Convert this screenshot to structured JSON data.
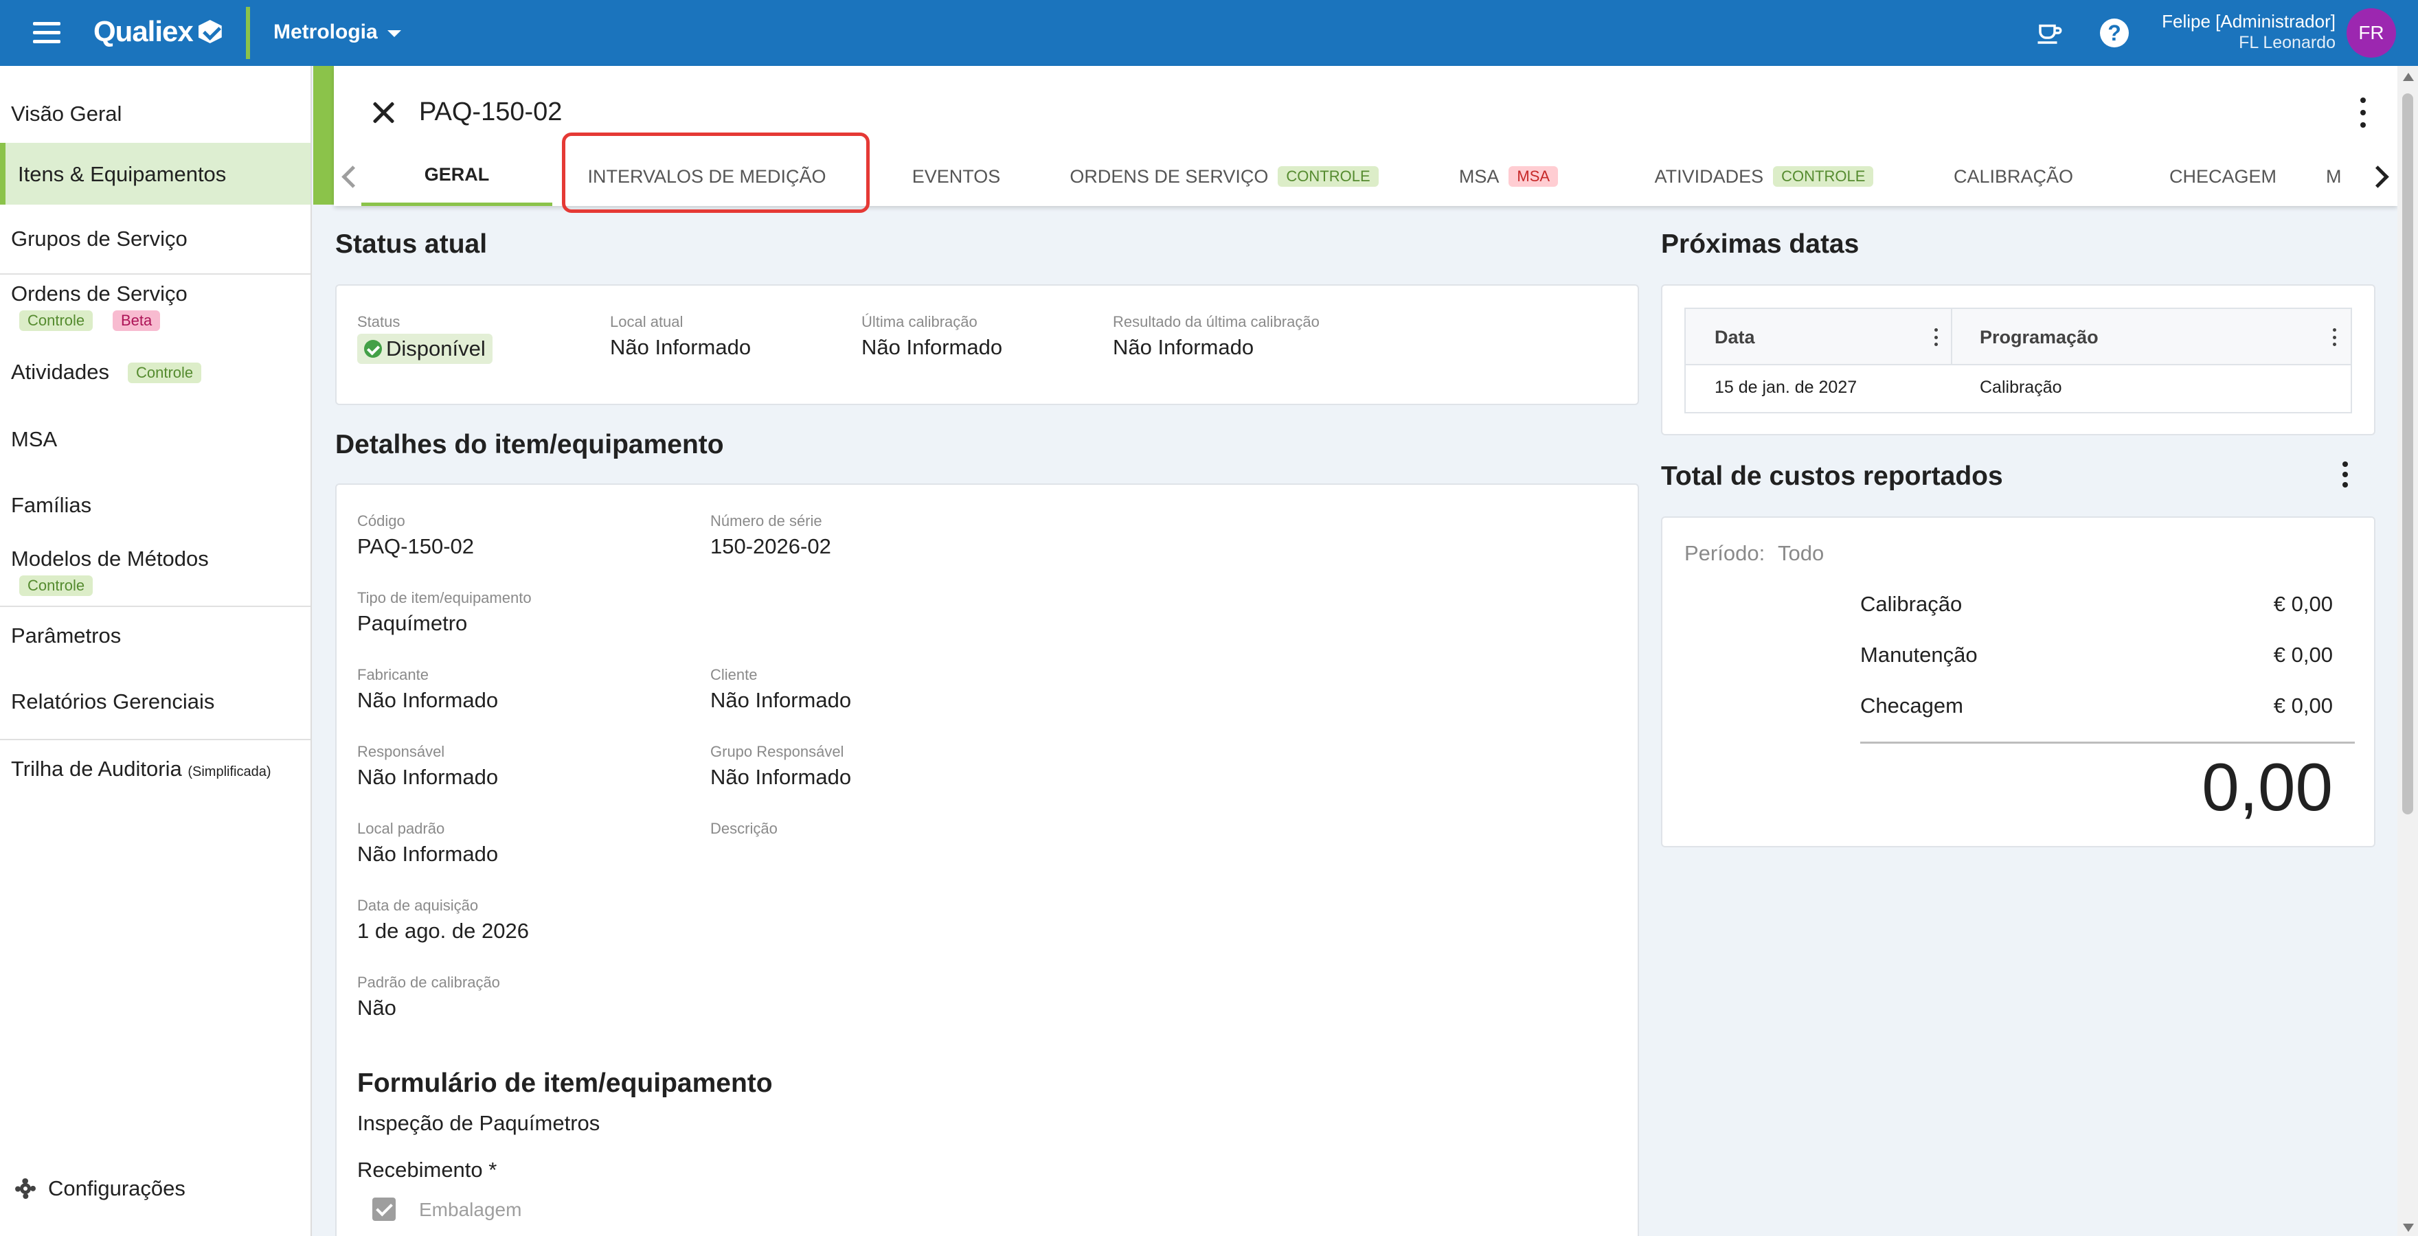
{
  "app": {
    "logo_text": "Qualiex",
    "module": "Metrologia",
    "user_name": "Felipe [Administrador]",
    "user_company": "FL Leonardo",
    "user_initials": "FR",
    "colors": {
      "topbar": "#1b74bd",
      "accent": "#8bc34a",
      "avatar": "#9c27b0",
      "highlight": "#e53935"
    }
  },
  "sidebar": {
    "items": [
      {
        "label": "Visão Geral"
      },
      {
        "label": "Itens & Equipamentos",
        "active": true
      },
      {
        "label": "Grupos de Serviço"
      },
      {
        "label": "Ordens de Serviço",
        "chips": [
          "Controle",
          "Beta"
        ]
      },
      {
        "label": "Atividades",
        "chips": [
          "Controle"
        ]
      },
      {
        "label": "MSA"
      },
      {
        "label": "Famílias"
      },
      {
        "label": "Modelos de Métodos",
        "chips": [
          "Controle"
        ]
      },
      {
        "label": "Parâmetros"
      },
      {
        "label": "Relatórios Gerenciais"
      },
      {
        "label": "Trilha de Auditoria",
        "note": "(Simplificada)"
      }
    ],
    "settings_label": "Configurações"
  },
  "header": {
    "title": "PAQ-150-02",
    "tabs": [
      {
        "label": "GERAL",
        "active": true
      },
      {
        "label": "INTERVALOS DE MEDIÇÃO"
      },
      {
        "label": "EVENTOS"
      },
      {
        "label": "ORDENS DE SERVIÇO",
        "chip": "Controle"
      },
      {
        "label": "MSA",
        "chip": "MSA"
      },
      {
        "label": "ATIVIDADES",
        "chip": "Controle"
      },
      {
        "label": "CALIBRAÇÃO"
      },
      {
        "label": "CHECAGEM"
      },
      {
        "label": "M"
      }
    ]
  },
  "status": {
    "section_title": "Status atual",
    "status_label": "Status",
    "status_value": "Disponível",
    "local_label": "Local atual",
    "local_value": "Não Informado",
    "ultima_label": "Última calibração",
    "ultima_value": "Não Informado",
    "resultado_label": "Resultado da última calibração",
    "resultado_value": "Não Informado"
  },
  "details": {
    "section_title": "Detalhes do item/equipamento",
    "codigo_label": "Código",
    "codigo_value": "PAQ-150-02",
    "serie_label": "Número de série",
    "serie_value": "150-2026-02",
    "tipo_label": "Tipo de item/equipamento",
    "tipo_value": "Paquímetro",
    "fabricante_label": "Fabricante",
    "fabricante_value": "Não Informado",
    "cliente_label": "Cliente",
    "cliente_value": "Não Informado",
    "responsavel_label": "Responsável",
    "responsavel_value": "Não Informado",
    "grupo_label": "Grupo Responsável",
    "grupo_value": "Não Informado",
    "local_label": "Local padrão",
    "local_value": "Não Informado",
    "descricao_label": "Descrição",
    "data_label": "Data de aquisição",
    "data_value": "1 de ago. de 2026",
    "padrao_label": "Padrão de calibração",
    "padrao_value": "Não",
    "form_title": "Formulário de item/equipamento",
    "form_name": "Inspeção de Paquímetros",
    "form_section": "Recebimento *",
    "form_check_label": "Embalagem"
  },
  "upcoming": {
    "section_title": "Próximas datas",
    "columns": [
      "Data",
      "Programação"
    ],
    "rows": [
      {
        "data": "15 de jan. de 2027",
        "programacao": "Calibração"
      }
    ]
  },
  "costs": {
    "section_title": "Total de custos reportados",
    "period_label": "Período:",
    "period_value": "Todo",
    "items": [
      {
        "label": "Calibração",
        "value": "€ 0,00"
      },
      {
        "label": "Manutenção",
        "value": "€ 0,00"
      },
      {
        "label": "Checagem",
        "value": "€ 0,00"
      }
    ],
    "total": "0,00"
  }
}
